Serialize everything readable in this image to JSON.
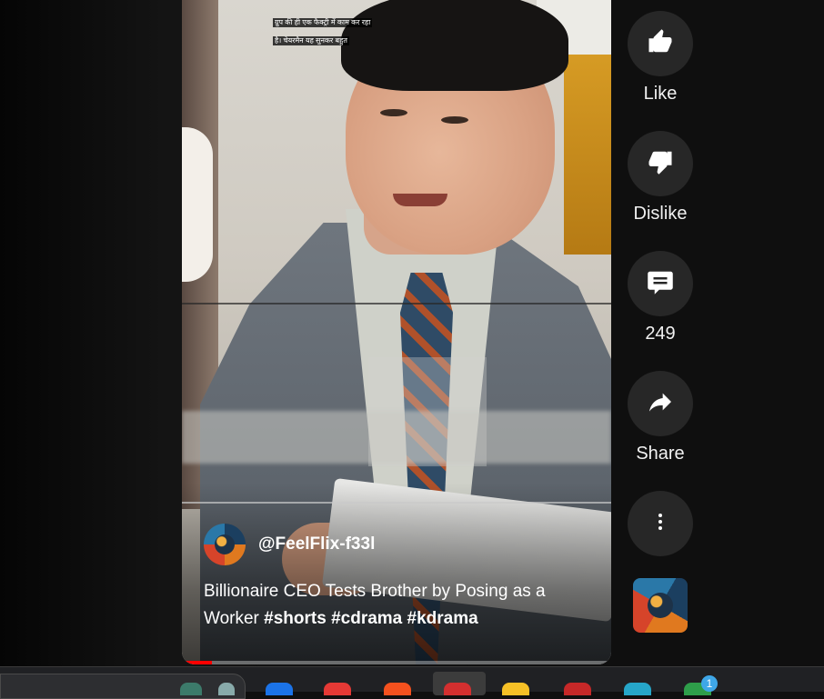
{
  "video": {
    "subtitle_lines": [
      "ग्रुप की ही एक फैक्ट्री में काम कर रहा",
      "है। चेयरमैन यह सुनकर बहुत"
    ],
    "channel_handle": "@FeelFlix-f33l",
    "title_plain": "Billionaire CEO Tests Brother by Posing as a Worker ",
    "title_tags": "#shorts #cdrama #kdrama",
    "progress": 0.07
  },
  "actions": {
    "like_label": "Like",
    "dislike_label": "Dislike",
    "comments_count": "249",
    "share_label": "Share"
  },
  "icons": [
    "thumb-up-icon",
    "thumb-down-icon",
    "comment-icon",
    "share-icon",
    "more-vert-icon"
  ],
  "taskbar": {
    "badge_count": "1"
  }
}
